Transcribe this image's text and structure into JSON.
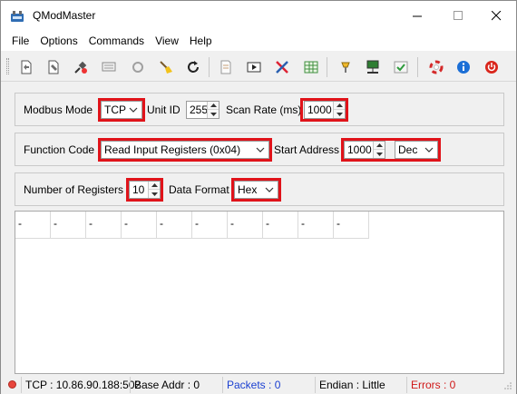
{
  "window": {
    "title": "QModMaster"
  },
  "menu": {
    "items": [
      "File",
      "Options",
      "Commands",
      "View",
      "Help"
    ]
  },
  "toolbar": {
    "icons": [
      "connect-icon",
      "disconnect-icon",
      "plug-icon",
      "bus-monitor-icon",
      "reset-icon",
      "clear-icon",
      "refresh-icon",
      "log-icon",
      "play-icon",
      "tools-icon",
      "table-icon",
      "lamp-icon",
      "network-icon",
      "check-icon",
      "help-ring-icon",
      "info-icon",
      "exit-icon"
    ]
  },
  "settings": {
    "modbus_mode_label": "Modbus Mode",
    "modbus_mode_value": "TCP",
    "unit_id_label": "Unit ID",
    "unit_id_value": "255",
    "scan_rate_label": "Scan Rate (ms)",
    "scan_rate_value": "1000",
    "function_code_label": "Function Code",
    "function_code_value": "Read Input Registers (0x04)",
    "start_address_label": "Start Address",
    "start_address_value": "1000",
    "address_format_value": "Dec",
    "num_registers_label": "Number of Registers",
    "num_registers_value": "10",
    "data_format_label": "Data Format",
    "data_format_value": "Hex"
  },
  "registers": [
    "-",
    "-",
    "-",
    "-",
    "-",
    "-",
    "-",
    "-",
    "-",
    "-"
  ],
  "status": {
    "connection": "TCP : 10.86.90.188:502",
    "base_addr": "Base Addr : 0",
    "packets": "Packets : 0",
    "endian": "Endian : Little",
    "errors": "Errors : 0"
  },
  "colors": {
    "highlight": "#e0131a",
    "packets_text": "#1a3fd1",
    "errors_text": "#d01818"
  }
}
